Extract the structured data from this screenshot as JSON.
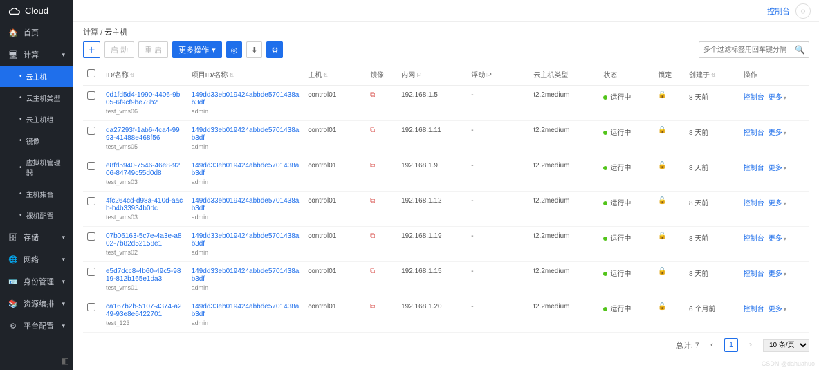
{
  "brand": "Cloud",
  "topbar": {
    "console": "控制台"
  },
  "breadcrumb": {
    "root": "计算",
    "current": "云主机"
  },
  "sidebar": {
    "items": [
      {
        "icon": "home",
        "label": "首页"
      },
      {
        "icon": "desktop",
        "label": "计算",
        "expand": "▾"
      },
      {
        "sub": true,
        "label": "云主机",
        "active": true
      },
      {
        "sub": true,
        "label": "云主机类型"
      },
      {
        "sub": true,
        "label": "云主机组"
      },
      {
        "sub": true,
        "label": "镜像"
      },
      {
        "sub": true,
        "label": "虚拟机管理器"
      },
      {
        "sub": true,
        "label": "主机集合"
      },
      {
        "sub": true,
        "label": "裸机配置"
      },
      {
        "icon": "db",
        "label": "存储",
        "expand": "▾"
      },
      {
        "icon": "globe",
        "label": "网络",
        "expand": "▾"
      },
      {
        "icon": "id",
        "label": "身份管理",
        "expand": "▾"
      },
      {
        "icon": "stack",
        "label": "资源编排",
        "expand": "▾"
      },
      {
        "icon": "gear",
        "label": "平台配置",
        "expand": "▾"
      }
    ]
  },
  "toolbar": {
    "create": "＋",
    "start": "启 动",
    "restart": "重 启",
    "more": "更多操作",
    "search_placeholder": "多个过滤标签用回车键分隔"
  },
  "columns": {
    "chk": "",
    "id": "ID/名称",
    "project": "项目ID/名称",
    "host": "主机",
    "image": "镜像",
    "ip": "内网IP",
    "floatip": "浮动IP",
    "type": "云主机类型",
    "status": "状态",
    "lock": "锁定",
    "created": "创建于",
    "actions": "操作"
  },
  "action_labels": {
    "console": "控制台",
    "more": "更多"
  },
  "rows": [
    {
      "id": "0d1fd5d4-1990-4406-9b05-6f9cf9be78b2",
      "name": "test_vms06",
      "proj_id": "149dd33eb019424abbde5701438ab3df",
      "proj_name": "admin",
      "host": "control01",
      "ip": "192.168.1.5",
      "floatip": "-",
      "type": "t2.2medium",
      "status": "运行中",
      "created": "8 天前"
    },
    {
      "id": "da27293f-1ab6-4ca4-9993-41488e468f56",
      "name": "test_vms05",
      "proj_id": "149dd33eb019424abbde5701438ab3df",
      "proj_name": "admin",
      "host": "control01",
      "ip": "192.168.1.11",
      "floatip": "-",
      "type": "t2.2medium",
      "status": "运行中",
      "created": "8 天前"
    },
    {
      "id": "e8fd5940-7546-46e8-9206-84749c55d0d8",
      "name": "test_vms03",
      "proj_id": "149dd33eb019424abbde5701438ab3df",
      "proj_name": "admin",
      "host": "control01",
      "ip": "192.168.1.9",
      "floatip": "-",
      "type": "t2.2medium",
      "status": "运行中",
      "created": "8 天前"
    },
    {
      "id": "4fc264cd-d98a-410d-aacb-b4b33934b0dc",
      "name": "test_vms03",
      "proj_id": "149dd33eb019424abbde5701438ab3df",
      "proj_name": "admin",
      "host": "control01",
      "ip": "192.168.1.12",
      "floatip": "-",
      "type": "t2.2medium",
      "status": "运行中",
      "created": "8 天前"
    },
    {
      "id": "07b06163-5c7e-4a3e-a802-7b82d52158e1",
      "name": "test_vms02",
      "proj_id": "149dd33eb019424abbde5701438ab3df",
      "proj_name": "admin",
      "host": "control01",
      "ip": "192.168.1.19",
      "floatip": "-",
      "type": "t2.2medium",
      "status": "运行中",
      "created": "8 天前"
    },
    {
      "id": "e5d7dcc8-4b60-49c5-9819-812b165e1da3",
      "name": "test_vms01",
      "proj_id": "149dd33eb019424abbde5701438ab3df",
      "proj_name": "admin",
      "host": "control01",
      "ip": "192.168.1.15",
      "floatip": "-",
      "type": "t2.2medium",
      "status": "运行中",
      "created": "8 天前"
    },
    {
      "id": "ca167b2b-5107-4374-a249-93e8e6422701",
      "name": "test_123",
      "proj_id": "149dd33eb019424abbde5701438ab3df",
      "proj_name": "admin",
      "host": "control01",
      "ip": "192.168.1.20",
      "floatip": "-",
      "type": "t2.2medium",
      "status": "运行中",
      "created": "6 个月前"
    }
  ],
  "pagination": {
    "total_label": "总计: 7",
    "page": "1",
    "per_page": "10 条/页"
  },
  "watermark": "CSDN @dahuahuo"
}
